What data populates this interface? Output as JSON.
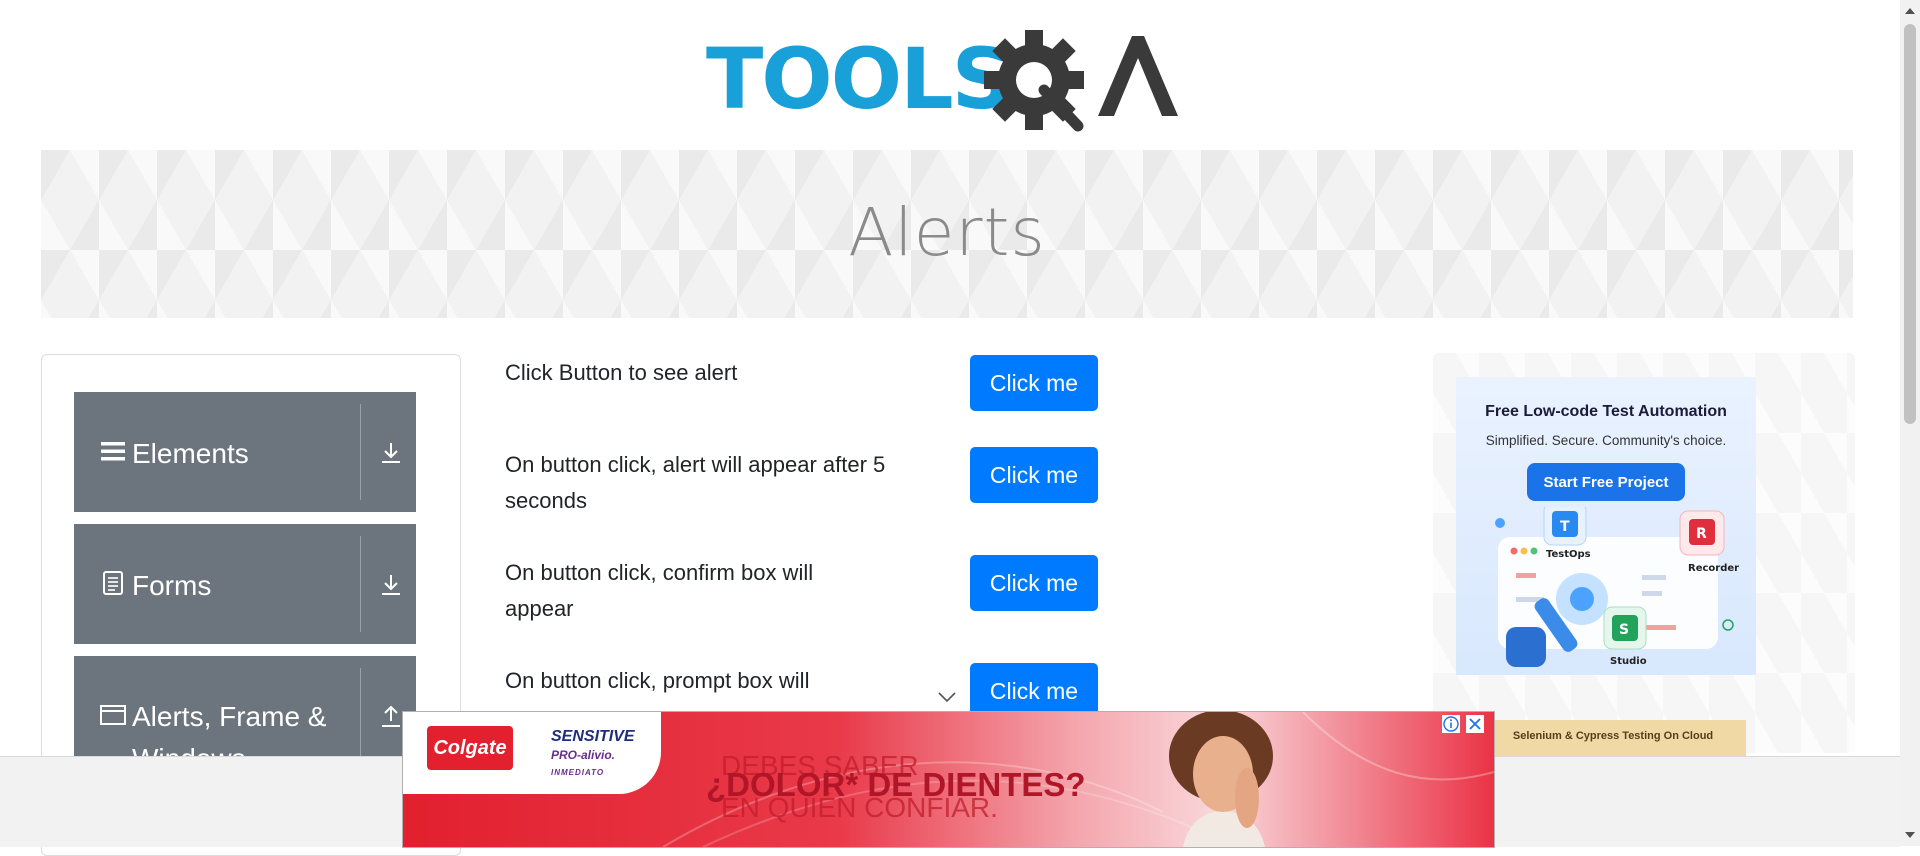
{
  "logo": {
    "alt": "TOOLSQA",
    "brand_color": "#1aa0d8",
    "gear_color": "#3a3a3a"
  },
  "banner": {
    "title": "Alerts"
  },
  "sidebar": {
    "groups": [
      {
        "label": "Elements",
        "icon": "hamburger-icon",
        "arrow": "download-arrow-icon"
      },
      {
        "label": "Forms",
        "icon": "document-icon",
        "arrow": "download-arrow-icon"
      },
      {
        "label": "Alerts, Frame & Windows",
        "icon": "window-icon",
        "arrow": "upload-arrow-icon"
      }
    ]
  },
  "alerts": {
    "rows": [
      {
        "text": "Click Button to see alert",
        "button": "Click me"
      },
      {
        "text": "On button click, alert will appear after 5 seconds",
        "button": "Click me"
      },
      {
        "text": "On button click, confirm box will appear",
        "button": "Click me"
      },
      {
        "text": "On button click, prompt box will",
        "button": "Click me"
      }
    ]
  },
  "right_ad": {
    "headline": "Free Low-code Test Automation",
    "subline": "Simplified. Secure. Community's choice.",
    "cta": "Start Free Project",
    "labels": {
      "testops": "TestOps",
      "recorder": "Recorder",
      "studio": "Studio"
    },
    "second_ad_text": "Selenium & Cypress Testing On Cloud"
  },
  "bottom_ad": {
    "brand": "Colgate",
    "product": "SENSITIVE",
    "product_sub": "PRO-alivio.",
    "product_tag": "INMEDIATO",
    "line1": "DEBES SABER",
    "line2": "¿DOLOR* DE DIENTES?",
    "line3": "EN QUIÉN CONFIAR."
  },
  "colors": {
    "primary_button": "#007bff",
    "sidebar_group": "#6c757d"
  }
}
